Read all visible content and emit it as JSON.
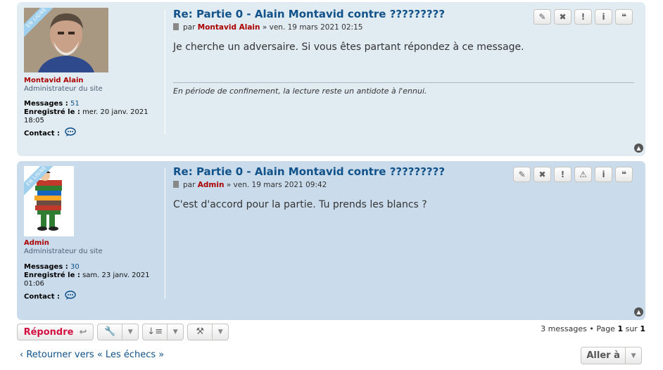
{
  "posts": [
    {
      "online_badge": "EN LIGNE",
      "username": "Montavid Alain",
      "rank": "Administrateur du site",
      "messages_label": "Messages :",
      "messages_count": "51",
      "registered_label": "Enregistré le :",
      "registered_date": "mer. 20 janv. 2021 18:05",
      "contact_label": "Contact :",
      "title": "Re: Partie 0 - Alain Montavid contre ?????????",
      "meta_by": "par",
      "meta_author": "Montavid Alain",
      "meta_date": "» ven. 19 mars 2021 02:15",
      "body": "Je cherche un adversaire. Si vous êtes partant répondez à ce message.",
      "signature": "En période de confinement, la lecture reste un antidote à l'ennui.",
      "actions": [
        "edit-icon",
        "delete-icon",
        "warn-icon",
        "info-icon",
        "quote-icon"
      ]
    },
    {
      "online_badge": "EN LIGNE",
      "username": "Admin",
      "rank": "Administrateur du site",
      "messages_label": "Messages :",
      "messages_count": "30",
      "registered_label": "Enregistré le :",
      "registered_date": "sam. 23 janv. 2021 01:06",
      "contact_label": "Contact :",
      "title": "Re: Partie 0 - Alain Montavid contre ?????????",
      "meta_by": "par",
      "meta_author": "Admin",
      "meta_date": "» ven. 19 mars 2021 09:42",
      "body": "C'est d'accord pour la partie. Tu prends les blancs ?",
      "actions": [
        "edit-icon",
        "delete-icon",
        "warn-icon",
        "report-icon",
        "info-icon",
        "quote-icon"
      ]
    }
  ],
  "footer": {
    "reply_label": "Répondre",
    "pagination_prefix": "3 messages • Page",
    "page_current": "1",
    "page_sep": "sur",
    "page_total": "1",
    "back_link": "‹ Retourner vers « Les échecs »",
    "jump_label": "Aller à"
  },
  "colors": {
    "post_bg_1": "#e1ebf2",
    "post_bg_2": "#cadceb",
    "username": "#aa0000",
    "link": "#105289",
    "reply": "#d31141"
  }
}
